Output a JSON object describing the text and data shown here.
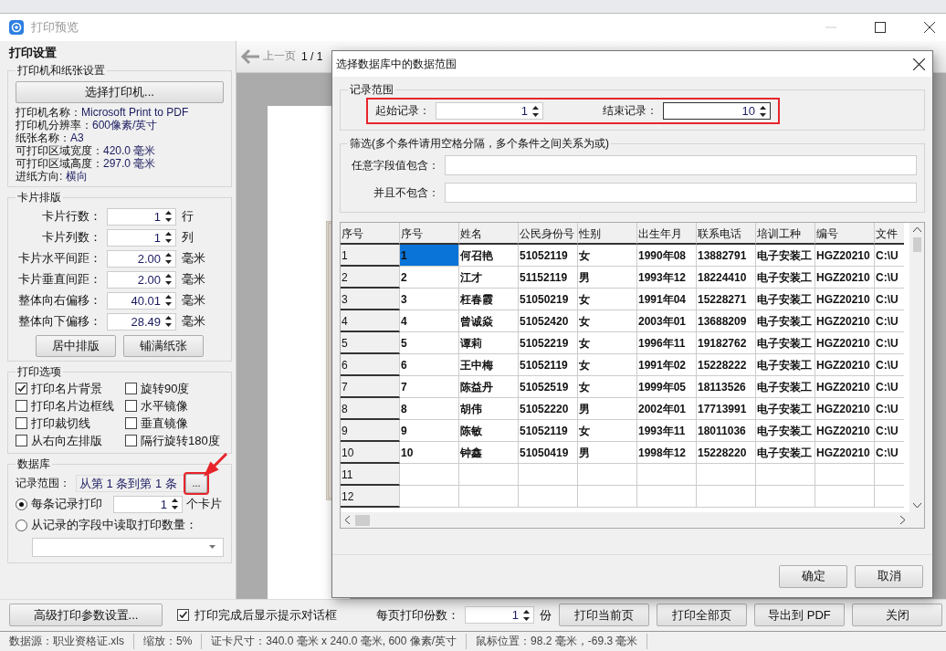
{
  "window": {
    "title": "打印预览"
  },
  "settings": {
    "title": "打印设置",
    "printer_group": {
      "title": "打印机和纸张设置",
      "button": "选择打印机...",
      "info": [
        {
          "label": "打印机名称：",
          "value": "Microsoft Print to PDF"
        },
        {
          "label": "打印机分辨率：",
          "value": "600像素/英寸"
        },
        {
          "label": "纸张名称：",
          "value": "A3"
        },
        {
          "label": "可打印区域宽度：",
          "value": "420.0 毫米"
        },
        {
          "label": "可打印区域高度：",
          "value": "297.0 毫米"
        },
        {
          "label": "进纸方向: ",
          "value": "横向"
        }
      ]
    },
    "layout_group": {
      "title": "卡片排版",
      "fields": [
        {
          "label": "卡片行数：",
          "value": "1",
          "unit": "行"
        },
        {
          "label": "卡片列数：",
          "value": "1",
          "unit": "列"
        },
        {
          "label": "卡片水平间距：",
          "value": "2.00",
          "unit": "毫米"
        },
        {
          "label": "卡片垂直间距：",
          "value": "2.00",
          "unit": "毫米"
        },
        {
          "label": "整体向右偏移：",
          "value": "40.01",
          "unit": "毫米"
        },
        {
          "label": "整体向下偏移：",
          "value": "28.49",
          "unit": "毫米"
        }
      ],
      "buttons": [
        "居中排版",
        "铺满纸张"
      ]
    },
    "options_group": {
      "title": "打印选项",
      "options": [
        {
          "label": "打印名片背景",
          "checked": true
        },
        {
          "label": "旋转90度",
          "checked": false
        },
        {
          "label": "打印名片边框线",
          "checked": false
        },
        {
          "label": "水平镜像",
          "checked": false
        },
        {
          "label": "打印裁切线",
          "checked": false
        },
        {
          "label": "垂直镜像",
          "checked": false
        },
        {
          "label": "从右向左排版",
          "checked": false
        },
        {
          "label": "隔行旋转180度",
          "checked": false
        }
      ]
    },
    "database_group": {
      "title": "数据库",
      "range_label": "记录范围：",
      "range_value": "从第 1 条到第 1 条",
      "more_button": "...",
      "highlighted": true,
      "modes": [
        {
          "label": "每条记录打印",
          "selected": true,
          "value": "1",
          "unit": "个卡片"
        },
        {
          "label": "从记录的字段中读取打印数量：",
          "selected": false
        }
      ]
    }
  },
  "toolbar": {
    "prev": "上一页",
    "page": "1 / 1"
  },
  "bottom_bar": {
    "advanced_button": "高级打印参数设置...",
    "notify": {
      "label": "打印完成后显示提示对话框",
      "checked": true
    },
    "copies_label": "每页打印份数：",
    "copies": "1",
    "copies_unit": "份",
    "buttons": [
      "打印当前页",
      "打印全部页",
      "导出到 PDF",
      "关闭"
    ]
  },
  "status_bar": [
    "数据源：职业资格证.xls",
    "缩放：5%",
    "证卡尺寸：340.0 毫米 x 240.0 毫米, 600 像素/英寸",
    "鼠标位置：98.2 毫米，-69.3 毫米"
  ],
  "dialog": {
    "title": "选择数据库中的数据范围",
    "range_group": {
      "title": "记录范围",
      "highlighted": true,
      "start_label": "起始记录：",
      "start": "1",
      "end_label": "结束记录：",
      "end": "10"
    },
    "filter_group": {
      "title": "筛选(多个条件请用空格分隔，多个条件之间关系为或)",
      "include_label": "任意字段值包含：",
      "exclude_label": "并且不包含："
    },
    "grid": {
      "corner": "序号",
      "columns": [
        "序号",
        "姓名",
        "公民身份号",
        "性别",
        "出生年月",
        "联系电话",
        "培训工种",
        "编号",
        "文件"
      ],
      "rows": [
        {
          "header": "1",
          "selected": true,
          "cells": [
            "1",
            "何召艳",
            "51052119",
            "女",
            "1990年08",
            "13882791",
            "电子安装工",
            "HGZ20210",
            "C:\\U"
          ]
        },
        {
          "header": "2",
          "selected": false,
          "cells": [
            "2",
            "江才",
            "51152119",
            "男",
            "1993年12",
            "18224410",
            "电子安装工",
            "HGZ20210",
            "C:\\U"
          ]
        },
        {
          "header": "3",
          "selected": false,
          "cells": [
            "3",
            "枉春霞",
            "51050219",
            "女",
            "1991年04",
            "15228271",
            "电子安装工",
            "HGZ20210",
            "C:\\U"
          ]
        },
        {
          "header": "4",
          "selected": false,
          "cells": [
            "4",
            "曾诚焱",
            "51052420",
            "女",
            "2003年01",
            "13688209",
            "电子安装工",
            "HGZ20210",
            "C:\\U"
          ]
        },
        {
          "header": "5",
          "selected": false,
          "cells": [
            "5",
            "谭莉",
            "51052219",
            "女",
            "1996年11",
            "19182762",
            "电子安装工",
            "HGZ20210",
            "C:\\U"
          ]
        },
        {
          "header": "6",
          "selected": false,
          "cells": [
            "6",
            "王中梅",
            "51052119",
            "女",
            "1991年02",
            "15228222",
            "电子安装工",
            "HGZ20210",
            "C:\\U"
          ]
        },
        {
          "header": "7",
          "selected": false,
          "cells": [
            "7",
            "陈益丹",
            "51052519",
            "女",
            "1999年05",
            "18113526",
            "电子安装工",
            "HGZ20210",
            "C:\\U"
          ]
        },
        {
          "header": "8",
          "selected": false,
          "cells": [
            "8",
            "胡伟",
            "51052220",
            "男",
            "2002年01",
            "17713991",
            "电子安装工",
            "HGZ20210",
            "C:\\U"
          ]
        },
        {
          "header": "9",
          "selected": false,
          "cells": [
            "9",
            "陈敏",
            "51052119",
            "女",
            "1993年11",
            "18011036",
            "电子安装工",
            "HGZ20210",
            "C:\\U"
          ]
        },
        {
          "header": "10",
          "selected": false,
          "cells": [
            "10",
            "钟鑫",
            "51050419",
            "男",
            "1998年12",
            "15228220",
            "电子安装工",
            "HGZ20210",
            "C:\\U"
          ]
        },
        {
          "header": "11",
          "selected": false,
          "cells": []
        },
        {
          "header": "12",
          "selected": false,
          "cells": []
        }
      ]
    },
    "buttons": [
      "确定",
      "取消"
    ]
  }
}
